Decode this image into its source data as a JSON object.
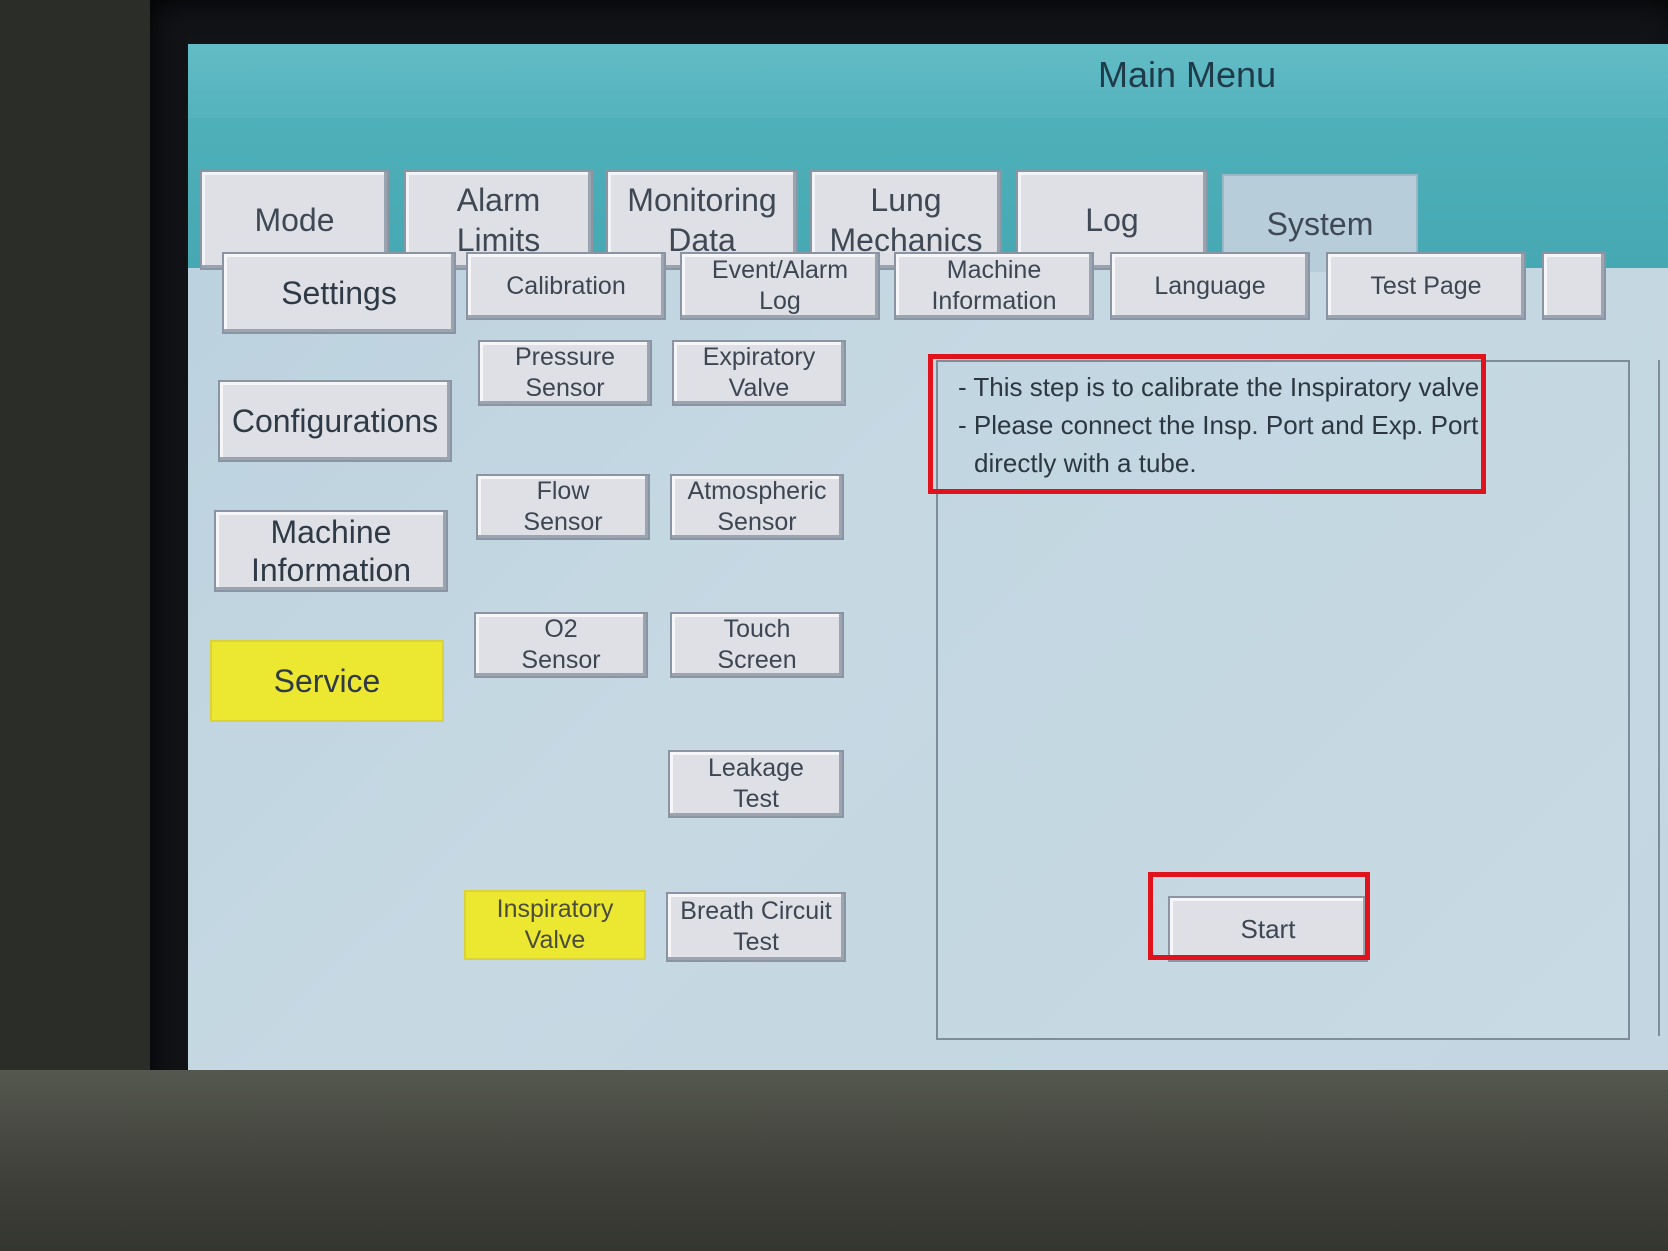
{
  "title": "Main Menu",
  "tabs": [
    {
      "label": "Mode"
    },
    {
      "label": "Alarm\nLimits"
    },
    {
      "label": "Monitoring\nData"
    },
    {
      "label": "Lung\nMechanics"
    },
    {
      "label": "Log"
    },
    {
      "label": "System",
      "active": true
    }
  ],
  "sidebar": [
    {
      "label": "Settings"
    },
    {
      "label": "Configurations"
    },
    {
      "label": "Machine\nInformation"
    },
    {
      "label": "Service",
      "active": true
    }
  ],
  "subtabs": [
    {
      "label": "Calibration"
    },
    {
      "label": "Event/Alarm\nLog"
    },
    {
      "label": "Machine\nInformation"
    },
    {
      "label": "Language"
    },
    {
      "label": "Test Page"
    }
  ],
  "calibration_items": [
    {
      "label": "Pressure\nSensor"
    },
    {
      "label": "Expiratory\nValve"
    },
    {
      "label": "Flow\nSensor"
    },
    {
      "label": "Atmospheric\nSensor"
    },
    {
      "label": "O2\nSensor"
    },
    {
      "label": "Touch\nScreen"
    },
    {
      "label": "Leakage\nTest"
    },
    {
      "label": "Inspiratory\nValve",
      "active": true
    },
    {
      "label": "Breath Circuit\nTest"
    }
  ],
  "instructions": {
    "line1": "- This step is to calibrate the Inspiratory valve.",
    "line2": "- Please connect the Insp. Port and Exp. Port",
    "line3": "directly with a tube."
  },
  "start_label": "Start",
  "colors": {
    "active_yellow": "#ece832",
    "highlight_red": "#e0121c",
    "header_teal": "#54b3bd"
  }
}
